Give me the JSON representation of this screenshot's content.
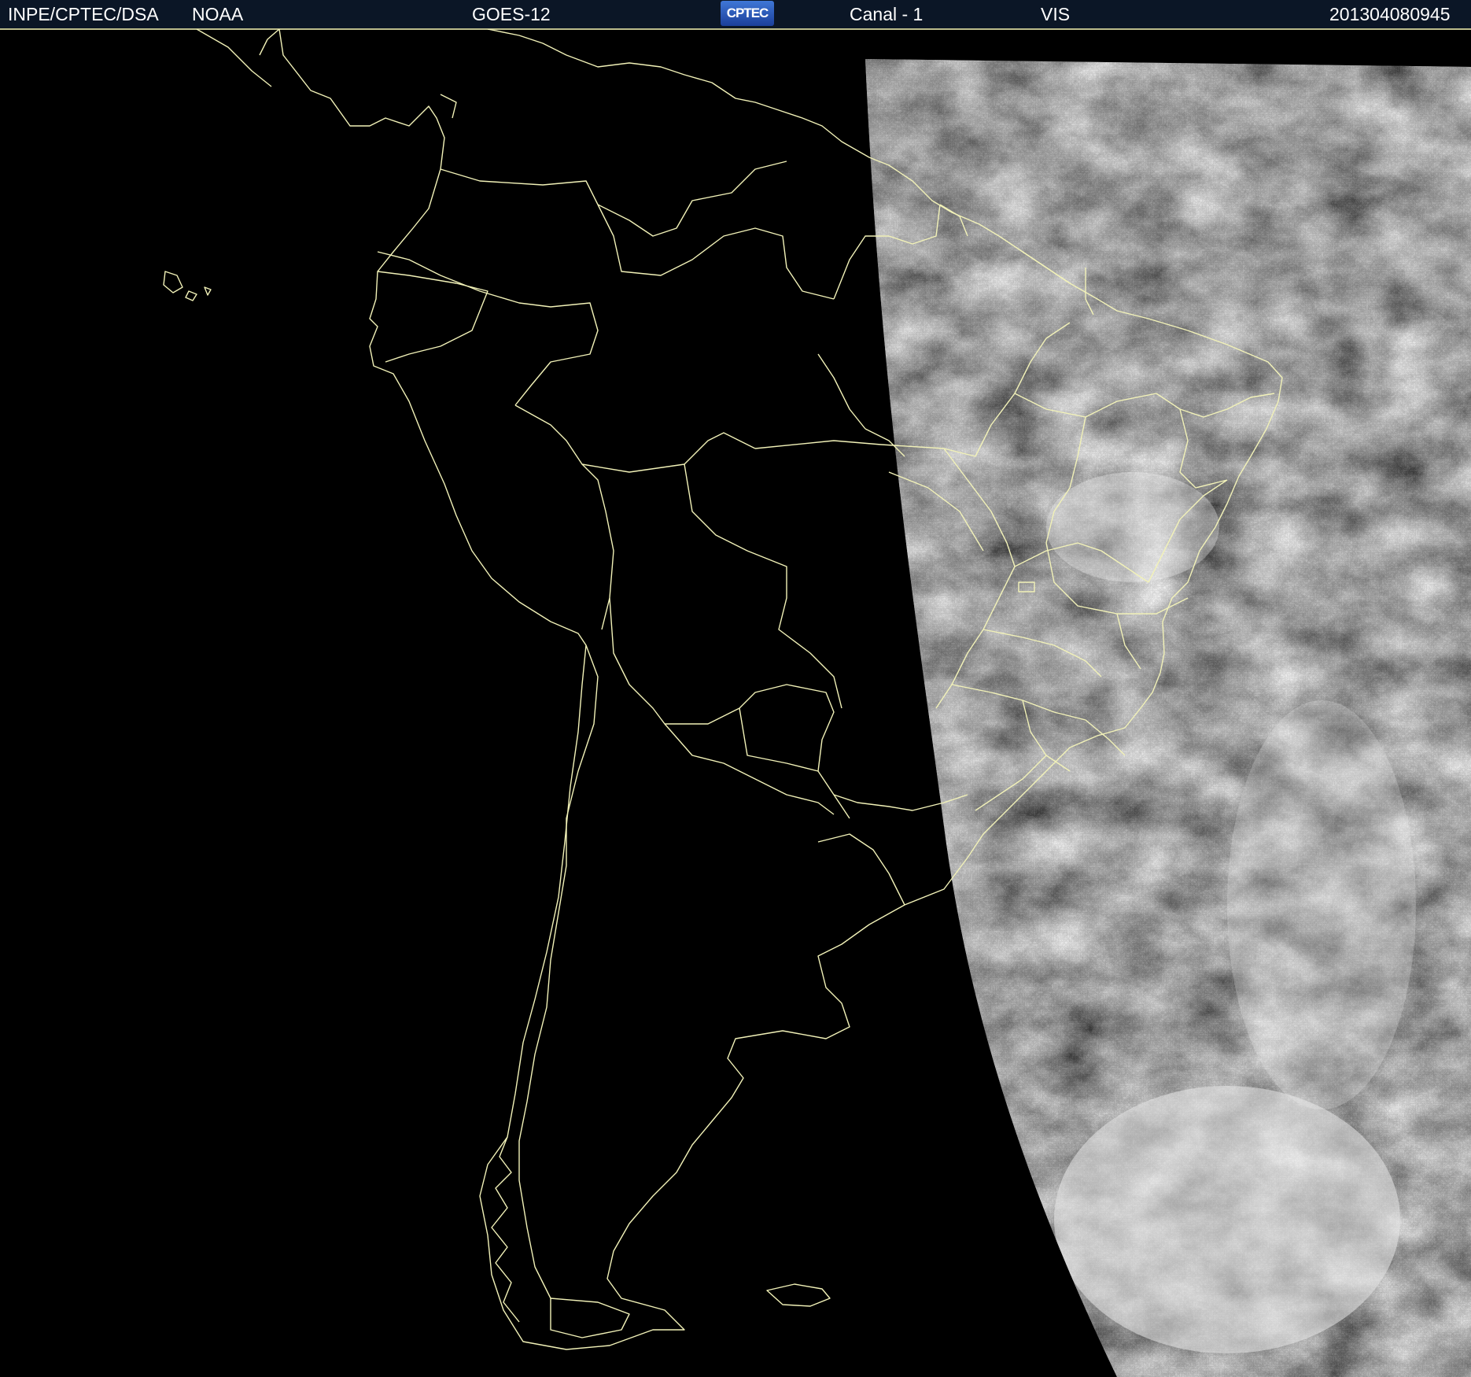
{
  "header": {
    "institution": "INPE/CPTEC/DSA",
    "agency": "NOAA",
    "satellite": "GOES-12",
    "logo_text": "CPTEC",
    "channel": "Canal - 1",
    "band": "VIS",
    "timestamp": "201304080945"
  },
  "colors": {
    "header_bg": "#0b1626",
    "border_lines": "#f2f2b8",
    "background": "#000000",
    "cloud_light": "#ffffff",
    "cloud_dark": "#4a4a4a"
  },
  "map": {
    "region": "South America",
    "layers": [
      "coastline",
      "country-borders",
      "brazil-state-borders",
      "visible-satellite-imagery"
    ]
  }
}
